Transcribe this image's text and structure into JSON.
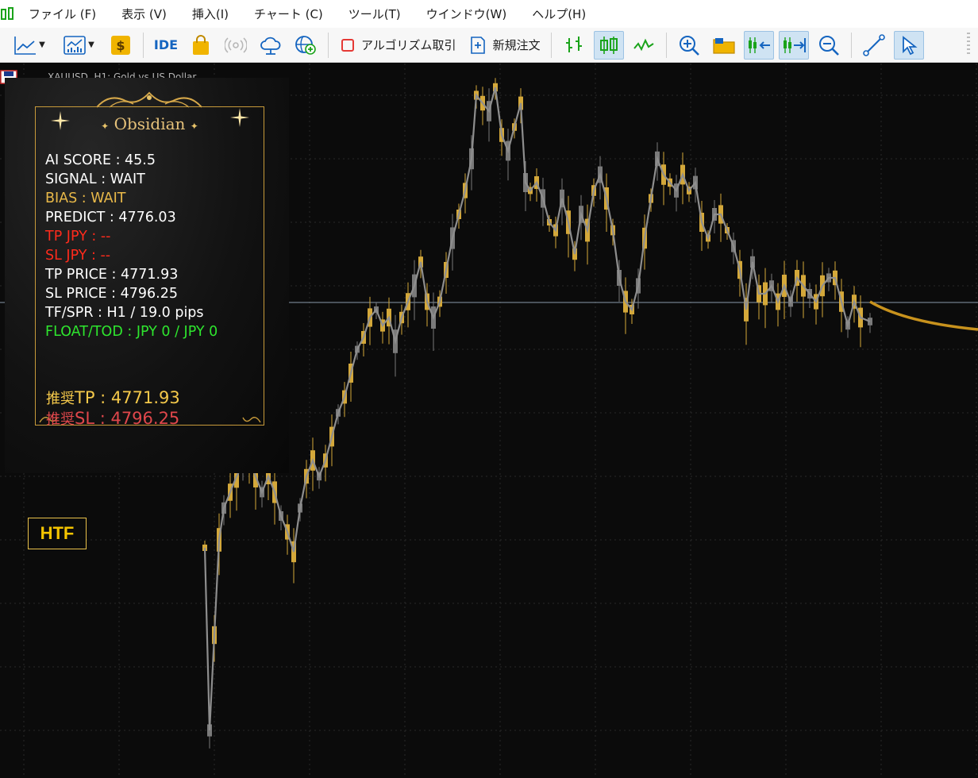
{
  "menubar": {
    "items": [
      "ファイル (F)",
      "表示 (V)",
      "挿入(I)",
      "チャート (C)",
      "ツール(T)",
      "ウインドウ(W)",
      "ヘルプ(H)"
    ]
  },
  "toolbar": {
    "ide_label": "IDE",
    "algo_label": "アルゴリズム取引",
    "new_order_label": "新規注文"
  },
  "chart": {
    "title": "XAUUSD, H1:  Gold vs US Dollar",
    "current_price_line": 4776.03,
    "prediction_color": "#c8921d"
  },
  "panel": {
    "title": "Obsidian",
    "ai_score": "AI SCORE : 45.5",
    "signal": "SIGNAL : WAIT",
    "bias": "BIAS : WAIT",
    "predict": "PREDICT : 4776.03",
    "tp_jpy": "TP JPY : --",
    "sl_jpy": "SL JPY : --",
    "tp_price": "TP PRICE : 4771.93",
    "sl_price": "SL PRICE : 4796.25",
    "tf_spr": "TF/SPR : H1 / 19.0 pips",
    "float_tod": "FLOAT/TOD : JPY 0 / JPY 0",
    "reco_prefix": "推奨",
    "reco_tp": "TP : 4771.93",
    "reco_sl": "SL : 4796.25"
  },
  "htf_badge": "HTF",
  "colors": {
    "bull_candle": "#d4a83a",
    "bear_candle": "#7a7a7a",
    "close_line": "#8e8e8e",
    "gold": "#c79a3a"
  }
}
